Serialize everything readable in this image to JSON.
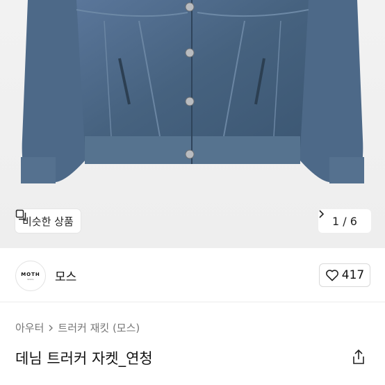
{
  "product_image": {
    "alt_icon": "denim-jacket-photo",
    "similar_button": {
      "label": "비슷한 상품",
      "icon": "similar-items-icon"
    },
    "counter": {
      "text": "1 / 6",
      "icon": "chevron-right-icon"
    }
  },
  "shop": {
    "logo_text": "MOTH",
    "logo_subtext": "SEOUL",
    "name": "모스",
    "like_count": "417",
    "like_icon": "heart-icon"
  },
  "breadcrumb": {
    "category": "아우터",
    "separator_icon": "chevron-right-icon",
    "subcategory": "트러커 재킷 (모스)"
  },
  "product": {
    "title": "데님 트러커 자켓_연청",
    "share_icon": "share-icon"
  },
  "colors": {
    "denim": "#4a6689",
    "denim_dark": "#34495f",
    "background": "#f0f0f0"
  }
}
